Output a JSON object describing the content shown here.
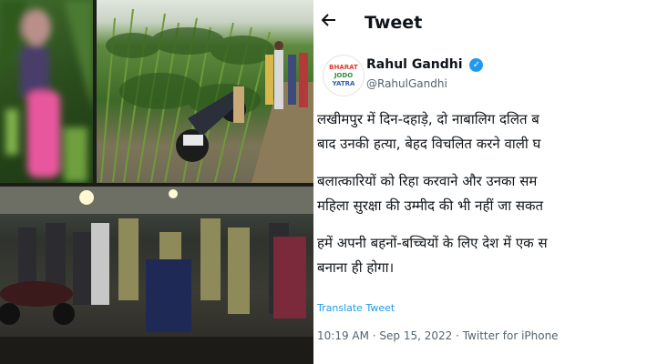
{
  "tweet": {
    "header_title": "Tweet",
    "back_icon": "arrow-left-icon",
    "author": {
      "name": "Rahul Gandhi",
      "handle": "@RahulGandhi",
      "avatar_logo_text": "BHARAT JODO YATRA",
      "verified_icon": "verified-badge-icon"
    },
    "paragraphs": [
      {
        "lines": [
          "लखीमपुर में दिन-दहाड़े, दो नाबालिग दलित ब",
          "बाद उनकी हत्या, बेहद विचलित करने वाली घ"
        ]
      },
      {
        "lines": [
          "बलात्कारियों को रिहा करवाने और उनका सम",
          "महिला सुरक्षा की उम्मीद की भी नहीं जा सकत"
        ]
      },
      {
        "lines": [
          "हमें अपनी बहनों-बच्चियों के लिए देश में एक स",
          "बनाना ही होगा।"
        ]
      }
    ],
    "translate_label": "Translate Tweet",
    "meta": "10:19 AM · Sep 15, 2022 · Twitter for iPhone"
  },
  "colors": {
    "link": "#1d9bf0",
    "text": "#0f1419",
    "muted": "#536471",
    "logo_red": "#e23a2f",
    "logo_green": "#2e8b3a",
    "logo_blue": "#2b5fbf"
  }
}
